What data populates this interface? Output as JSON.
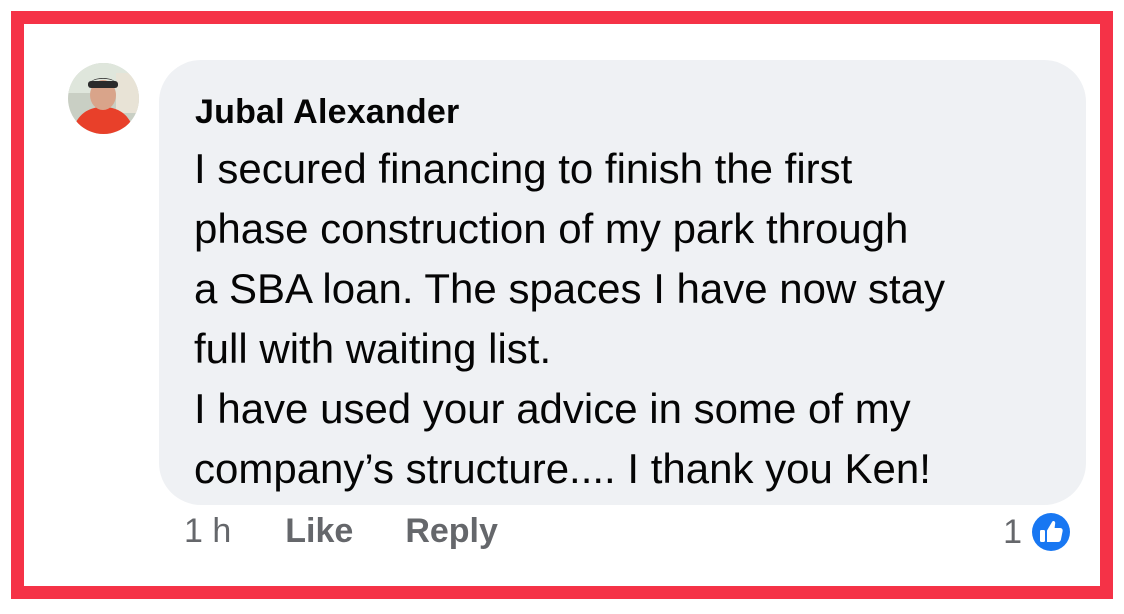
{
  "comment": {
    "author": "Jubal Alexander",
    "avatar_icon": "profile-photo",
    "text_lines": [
      "I secured financing to finish the first",
      "phase construction of my park through",
      "a SBA loan. The spaces I have now stay",
      "full with waiting list.",
      "I have used your advice in some of my",
      "company’s structure.... I thank you Ken!"
    ],
    "timestamp": "1 h",
    "actions": {
      "like_label": "Like",
      "reply_label": "Reply"
    },
    "reactions": {
      "count": "1",
      "icon": "like-thumbs-up-icon",
      "color": "#1877f2"
    }
  },
  "colors": {
    "frame_border": "#f53247",
    "bubble_background": "#eff1f4",
    "secondary_text": "#65676b",
    "primary_text": "#050505"
  }
}
